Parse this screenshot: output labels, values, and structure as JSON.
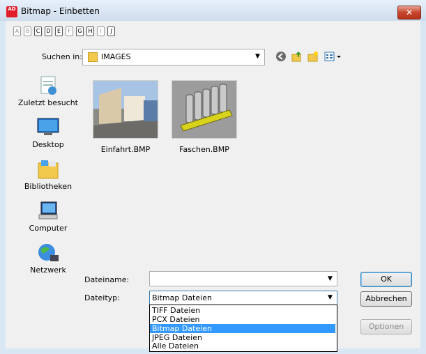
{
  "window": {
    "title": "Bitmap - Einbetten",
    "close_symbol": "✕",
    "app_icon_text": "AD"
  },
  "drives": [
    "A",
    "B",
    "C",
    "D",
    "E",
    "F",
    "G",
    "H",
    "I",
    "J"
  ],
  "look_in": {
    "label": "Suchen in:",
    "value": "IMAGES"
  },
  "places": [
    "Zuletzt besucht",
    "Desktop",
    "Bibliotheken",
    "Computer",
    "Netzwerk"
  ],
  "files": [
    "Einfahrt.BMP",
    "Faschen.BMP"
  ],
  "filename": {
    "label": "Dateiname:",
    "value": ""
  },
  "filetype": {
    "label": "Dateityp:",
    "value": "Bitmap Dateien",
    "options": [
      "TIFF Dateien",
      "PCX Dateien",
      "Bitmap Dateien",
      "JPEG Dateien",
      "Alle Dateien"
    ]
  },
  "buttons": {
    "ok": "OK",
    "cancel": "Abbrechen",
    "options": "Optionen"
  },
  "colors": {
    "selection": "#3399ff",
    "title_close": "#c7472c"
  }
}
